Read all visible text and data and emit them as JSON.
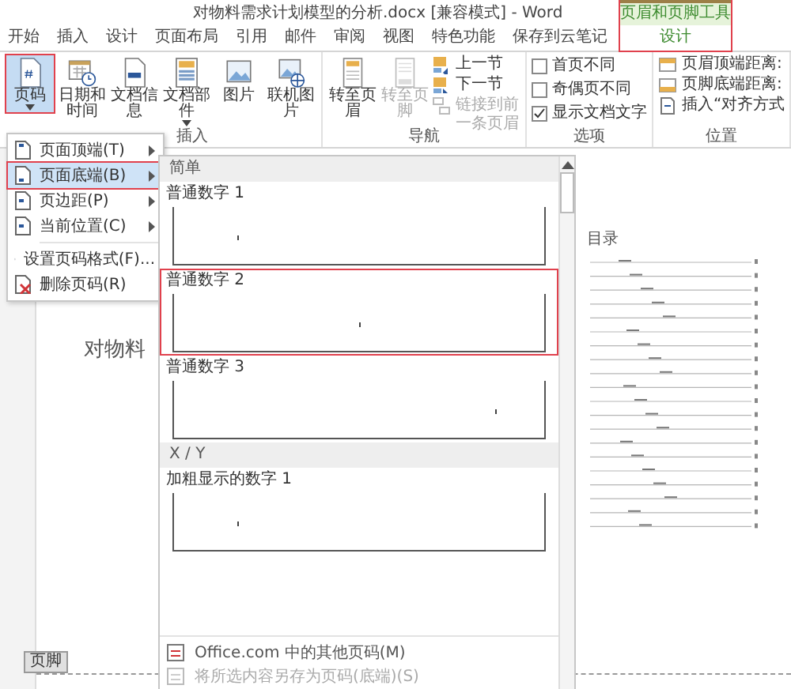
{
  "window": {
    "title": "对物料需求计划模型的分析.docx [兼容模式] - Word"
  },
  "contextual_group": {
    "label": "页眉和页脚工具"
  },
  "tabs": [
    {
      "label": "开始",
      "kind": "normal",
      "selected": false
    },
    {
      "label": "插入",
      "kind": "normal",
      "selected": false
    },
    {
      "label": "设计",
      "kind": "normal",
      "selected": false
    },
    {
      "label": "页面布局",
      "kind": "normal",
      "selected": false
    },
    {
      "label": "引用",
      "kind": "normal",
      "selected": false
    },
    {
      "label": "邮件",
      "kind": "normal",
      "selected": false
    },
    {
      "label": "审阅",
      "kind": "normal",
      "selected": false
    },
    {
      "label": "视图",
      "kind": "normal",
      "selected": false
    },
    {
      "label": "特色功能",
      "kind": "normal",
      "selected": false
    },
    {
      "label": "保存到云笔记",
      "kind": "normal",
      "selected": false
    },
    {
      "label": "设计",
      "kind": "contextual",
      "selected": true
    }
  ],
  "ribbon": {
    "groups": [
      {
        "label": "插入",
        "items": [
          {
            "kind": "big",
            "label": "页码",
            "selected": true,
            "disabled": false,
            "dropdown": true
          },
          {
            "kind": "big",
            "label": "日期和时间",
            "selected": false,
            "disabled": false,
            "dropdown": false
          },
          {
            "kind": "big",
            "label": "文档信息",
            "selected": false,
            "disabled": false,
            "dropdown": false
          },
          {
            "kind": "big",
            "label": "文档部件",
            "selected": false,
            "disabled": false,
            "dropdown": true
          },
          {
            "kind": "big",
            "label": "图片",
            "selected": false,
            "disabled": false,
            "dropdown": false
          },
          {
            "kind": "big",
            "label": "联机图片",
            "selected": false,
            "disabled": false,
            "dropdown": false
          }
        ]
      },
      {
        "label": "导航",
        "items": [
          {
            "kind": "big",
            "label": "转至页眉",
            "selected": false,
            "disabled": false,
            "dropdown": false
          },
          {
            "kind": "big",
            "label": "转至页脚",
            "selected": false,
            "disabled": true,
            "dropdown": false
          },
          {
            "kind": "small",
            "label": "上一节",
            "disabled": false
          },
          {
            "kind": "small",
            "label": "下一节",
            "disabled": false
          },
          {
            "kind": "small",
            "label": "链接到前一条页眉",
            "disabled": true
          }
        ]
      },
      {
        "label": "选项",
        "items": [
          {
            "kind": "checkbox",
            "label": "首页不同",
            "checked": false
          },
          {
            "kind": "checkbox",
            "label": "奇偶页不同",
            "checked": false
          },
          {
            "kind": "checkbox",
            "label": "显示文档文字",
            "checked": true
          }
        ]
      },
      {
        "label": "位置",
        "items": [
          {
            "kind": "small",
            "label": "页眉顶端距离:",
            "disabled": false
          },
          {
            "kind": "small",
            "label": "页脚底端距离:",
            "disabled": false
          },
          {
            "kind": "small",
            "label": "插入“对齐方式",
            "disabled": false
          }
        ]
      }
    ]
  },
  "menu": {
    "items": [
      {
        "label": "页面顶端(T)",
        "submenu": true,
        "selected": false
      },
      {
        "label": "页面底端(B)",
        "submenu": true,
        "selected": true
      },
      {
        "label": "页边距(P)",
        "submenu": true,
        "selected": false
      },
      {
        "label": "当前位置(C)",
        "submenu": true,
        "selected": false
      },
      {
        "label": "设置页码格式(F)...",
        "submenu": false,
        "selected": false
      },
      {
        "label": "删除页码(R)",
        "submenu": false,
        "selected": false
      }
    ]
  },
  "gallery": {
    "sections": [
      {
        "title": "简单",
        "items": [
          {
            "label": "普通数字 1",
            "kind": "left",
            "selected": false
          },
          {
            "label": "普通数字 2",
            "kind": "center",
            "selected": true
          },
          {
            "label": "普通数字 3",
            "kind": "right",
            "selected": false
          }
        ]
      },
      {
        "title": "X / Y",
        "items": [
          {
            "label": "加粗显示的数字 1",
            "kind": "left",
            "selected": false
          }
        ]
      }
    ],
    "commands": [
      {
        "label": "Office.com 中的其他页码(M)",
        "disabled": false
      },
      {
        "label": "将所选内容另存为页码(底端)(S)",
        "disabled": true
      }
    ]
  },
  "document": {
    "body_text": "对物料",
    "toc_title": "目录",
    "footer_tag": "页脚"
  }
}
